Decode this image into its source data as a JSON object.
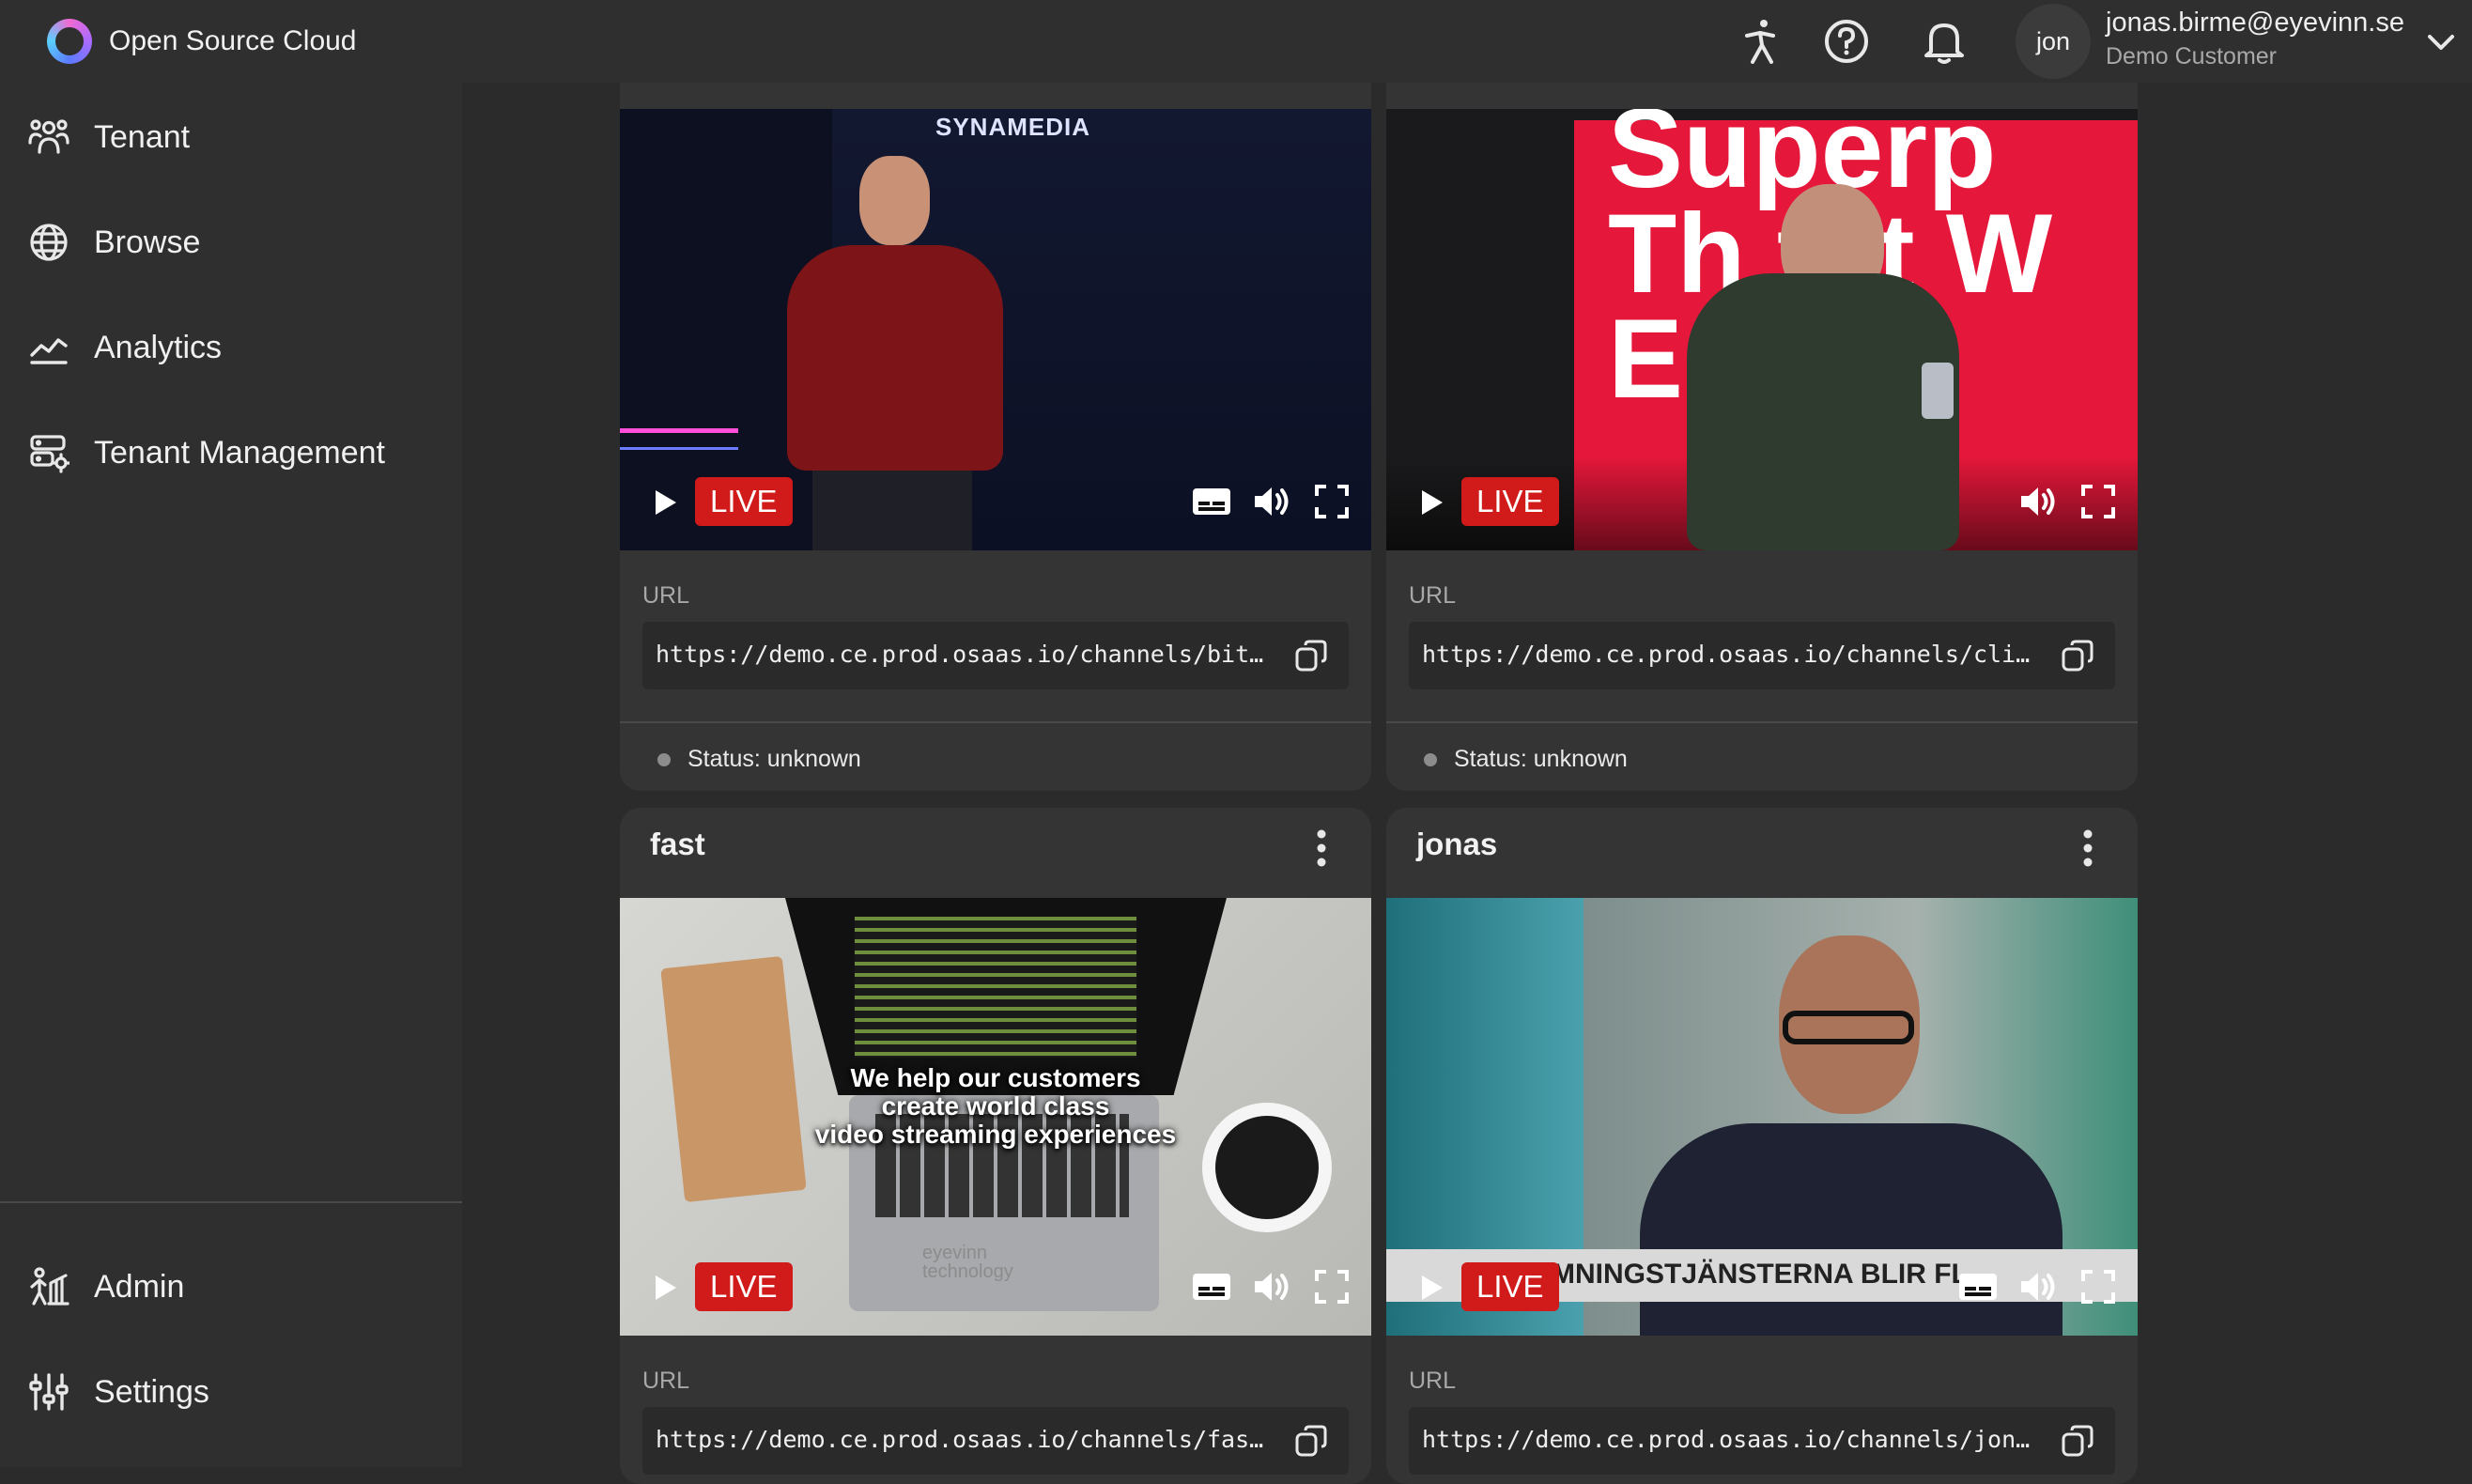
{
  "app": {
    "name": "Open Source Cloud"
  },
  "header": {
    "user": {
      "avatar_text": "jon",
      "email": "jonas.birme@eyevinn.se",
      "role": "Demo Customer"
    },
    "icons": [
      "accessibility-icon",
      "help-icon",
      "bell-icon",
      "chevron-down-icon"
    ]
  },
  "sidebar": {
    "items": [
      {
        "label": "Tenant",
        "icon": "users-icon"
      },
      {
        "label": "Browse",
        "icon": "globe-icon"
      },
      {
        "label": "Analytics",
        "icon": "chart-line-icon"
      },
      {
        "label": "Tenant Management",
        "icon": "server-settings-icon"
      }
    ],
    "bottom_items": [
      {
        "label": "Admin",
        "icon": "admin-icon"
      },
      {
        "label": "Settings",
        "icon": "sliders-icon"
      }
    ]
  },
  "channels": [
    {
      "title": "",
      "live_label": "LIVE",
      "url_label": "URL",
      "url": "https://demo.ce.prod.osaas.io/channels/bitm…",
      "status": "Status: unknown",
      "video_text": "SYNAMEDIA",
      "has_subtitles": true
    },
    {
      "title": "",
      "live_label": "LIVE",
      "url_label": "URL",
      "url": "https://demo.ce.prod.osaas.io/channels/cli/…",
      "status": "Status: unknown",
      "video_text": "Superp Th t It W E s c",
      "has_subtitles": false
    },
    {
      "title": "fast",
      "live_label": "LIVE",
      "url_label": "URL",
      "url": "https://demo.ce.prod.osaas.io/channels/fast…",
      "video_caption": [
        "We help our customers",
        "create world class",
        "video streaming experiences"
      ],
      "video_logo_text": [
        "eyevinn",
        "technology"
      ],
      "has_subtitles": true
    },
    {
      "title": "jonas",
      "live_label": "LIVE",
      "url_label": "URL",
      "url": "https://demo.ce.prod.osaas.io/channels/jona…",
      "video_text": "MNINGSTJÄNSTERNA BLIR FL",
      "has_subtitles": true
    }
  ],
  "colors": {
    "background": "#2b2b2b",
    "panel": "#2f2f2f",
    "card": "#343434",
    "live_badge": "#d11a1a",
    "status_dot": "#8c8c8c"
  }
}
